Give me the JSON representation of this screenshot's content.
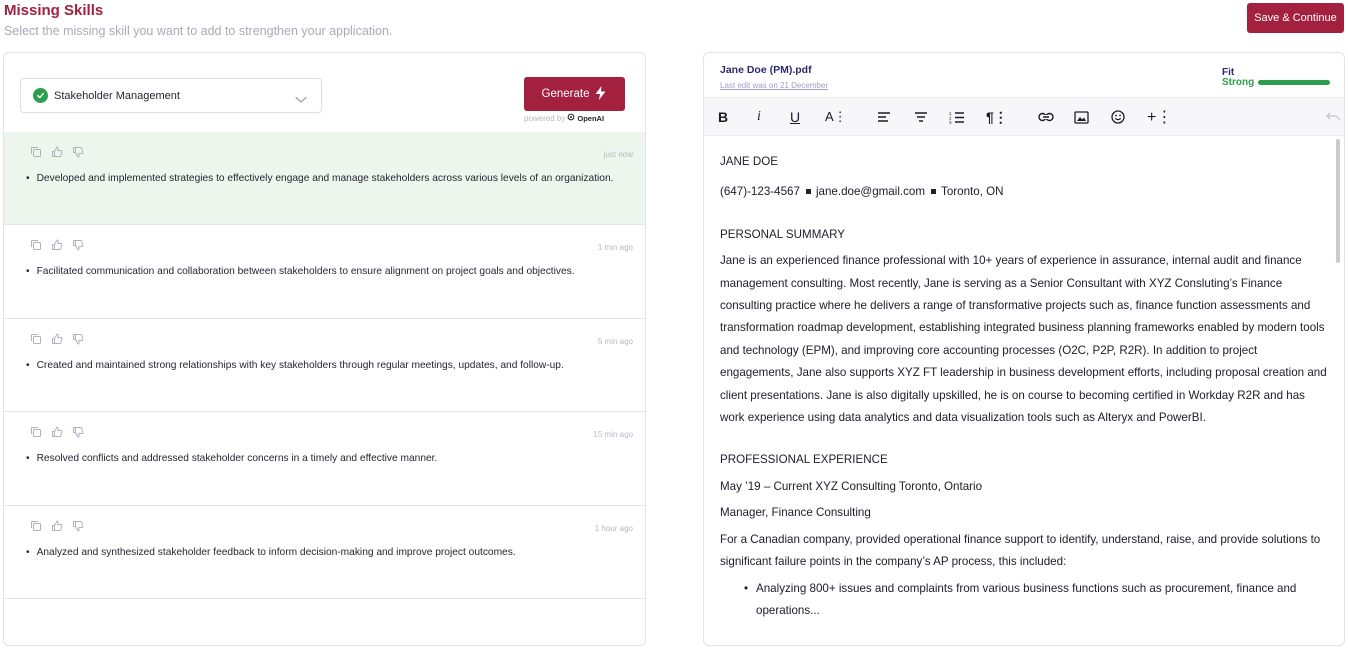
{
  "header": {
    "title": "Missing Skills",
    "subtitle": "Select the missing skill you want to add to strengthen your application.",
    "save_label": "Save & Continue"
  },
  "skill_select": {
    "selected": "Stakeholder Management"
  },
  "generate": {
    "label": "Generate",
    "powered_by": "powered by",
    "provider": "OpenAI"
  },
  "suggestions": [
    {
      "time": "just now",
      "text": "Developed and implemented strategies to effectively engage and manage stakeholders across various levels of an organization.",
      "selected": true
    },
    {
      "time": "1 min ago",
      "text": "Facilitated communication and collaboration between stakeholders to ensure alignment on project goals and objectives."
    },
    {
      "time": "5 min ago",
      "text": "Created and maintained strong relationships with key stakeholders through regular meetings, updates, and follow-up."
    },
    {
      "time": "15 min ago",
      "text": "Resolved conflicts and addressed stakeholder concerns in a timely and effective manner."
    },
    {
      "time": "1 hour ago",
      "text": "Analyzed and synthesized stakeholder feedback to inform decision-making and improve project outcomes."
    }
  ],
  "document": {
    "file_name": "Jane Doe (PM).pdf",
    "last_edit": "Last edit was on 21 December",
    "fit_label": "Fit",
    "fit_value": "Strong",
    "fit_level": 1.0,
    "name": "JANE DOE",
    "phone": "(647)-123-4567",
    "email": "jane.doe@gmail.com",
    "location": "Toronto, ON",
    "summary_heading": "PERSONAL SUMMARY",
    "summary": "Jane is an experienced finance professional with 10+ years of experience in assurance, internal audit and finance management consulting. Most recently, Jane is serving as a Senior Consultant with XYZ Consluting’s Finance consulting practice where he delivers a range of transformative projects such as, finance function assessments and transformation roadmap development, establishing integrated business planning frameworks enabled by modern tools and technology (EPM), and improving core accounting processes (O2C, P2P, R2R). In addition to project engagements, Jane also supports XYZ FT leadership in business development efforts, including proposal creation and client presentations. Jane is also digitally upskilled, he is on course to becoming certified in Workday R2R and has work experience using data analytics and data visualization tools such as Alteryx and PowerBI.",
    "experience_heading": "PROFESSIONAL EXPERIENCE",
    "job_line": "May ’19 – Current XYZ Consulting Toronto, Ontario",
    "job_title": "Manager, Finance Consulting",
    "job_desc": "For a Canadian company, provided operational finance support to identify, understand, raise, and provide solutions to significant failure points in the company’s AP process, this included:",
    "bullets": [
      "Analyzing 800+ issues and complaints from various business functions such as procurement, finance and operations..."
    ]
  },
  "toolbar_icons": [
    "bold-icon",
    "italic-icon",
    "underline-icon",
    "font-size-icon",
    "align-left-icon",
    "align-center-icon",
    "ordered-list-icon",
    "paragraph-icon",
    "link-icon",
    "image-icon",
    "emoji-icon",
    "insert-icon",
    "undo-icon"
  ],
  "colors": {
    "brand": "#a3203f",
    "success": "#2e9e4e",
    "selected_bg": "#ecf6ec",
    "navy": "#2a2a6e"
  }
}
